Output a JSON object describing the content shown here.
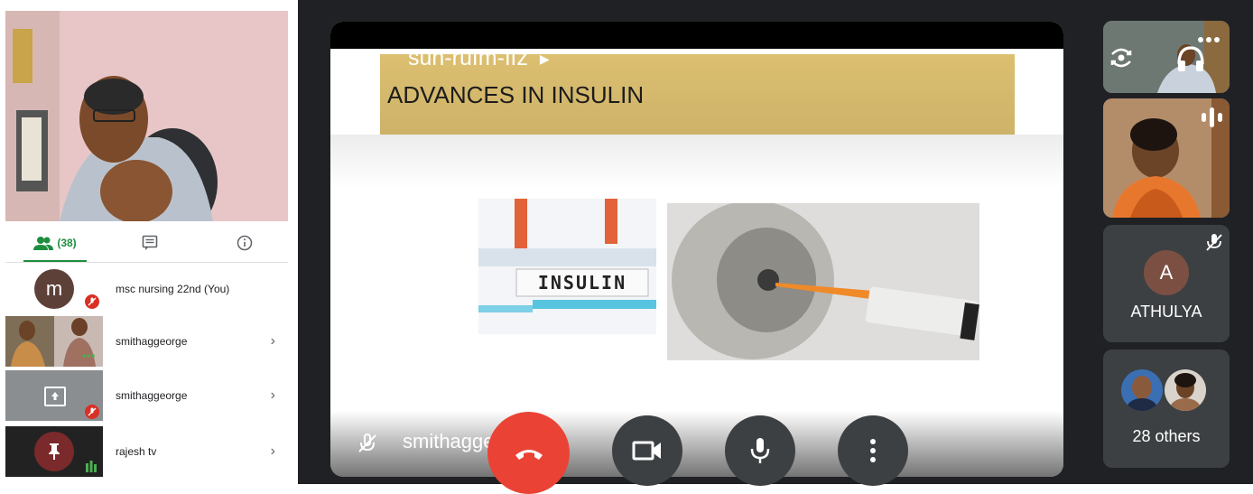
{
  "meeting": {
    "code": "sun-rufm-ffz",
    "slide_title": "ADVANCES IN INSULIN",
    "slide_image_text": "INSULIN",
    "presenter_caption": "smithaggeorge"
  },
  "tabs": {
    "people_count": "(38)"
  },
  "participants": [
    {
      "avatar_letter": "m",
      "name": "msc nursing 22nd (You)"
    },
    {
      "name": "smithaggeorge"
    },
    {
      "name": "smithaggeorge"
    },
    {
      "name": "rajesh tv"
    }
  ],
  "tiles": {
    "athulya_letter": "A",
    "athulya_name": "ATHULYA",
    "others_label": "28 others"
  },
  "icons": [
    "people-icon",
    "chat-icon",
    "info-icon",
    "mic-off-icon",
    "present-icon",
    "pin-icon",
    "audio-bars-icon",
    "chevron-right-icon",
    "back-arrow-icon",
    "end-call-icon",
    "camera-icon",
    "mic-icon",
    "more-vert-icon",
    "switch-camera-icon",
    "headphones-icon",
    "more-horiz-icon"
  ],
  "colors": {
    "accent": "#1e8e3e",
    "end_call": "#ea4335",
    "control": "#3c4043",
    "stage": "#202124"
  }
}
